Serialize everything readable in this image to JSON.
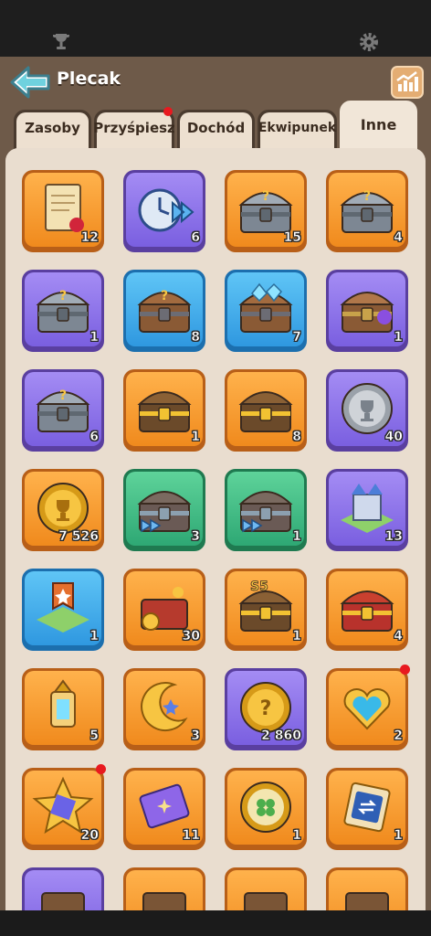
{
  "header": {
    "title": "Plecak",
    "back_icon": "back-arrow-icon",
    "stats_icon": "stats-chart-icon"
  },
  "top_icons": {
    "left": "trophy-icon",
    "right": "gear-icon"
  },
  "tabs": [
    {
      "label": "Zasoby",
      "active": false,
      "badge": false
    },
    {
      "label": "Przyśpiesz",
      "active": false,
      "badge": true
    },
    {
      "label": "Dochód",
      "active": false,
      "badge": false
    },
    {
      "label": "Ekwipunek",
      "active": false,
      "badge": false
    },
    {
      "label": "Inne",
      "active": true,
      "badge": false
    }
  ],
  "items": [
    {
      "icon": "scroll-icon",
      "count": "12",
      "rarity": "orange",
      "badge": false
    },
    {
      "icon": "speedup-clock-icon",
      "count": "6",
      "rarity": "purple",
      "badge": false
    },
    {
      "icon": "mystery-chest-silver-icon",
      "count": "15",
      "rarity": "orange",
      "badge": false
    },
    {
      "icon": "mystery-chest-ticket-icon",
      "count": "4",
      "rarity": "orange",
      "badge": false
    },
    {
      "icon": "mystery-chest-key-icon",
      "count": "1",
      "rarity": "purple",
      "badge": false
    },
    {
      "icon": "mystery-chest-wood-icon",
      "count": "8",
      "rarity": "blue",
      "badge": false
    },
    {
      "icon": "crystal-chest-icon",
      "count": "7",
      "rarity": "blue",
      "badge": false
    },
    {
      "icon": "gem-chest-icon",
      "count": "1",
      "rarity": "purple",
      "badge": false
    },
    {
      "icon": "iron-chest-icon",
      "count": "6",
      "rarity": "purple",
      "badge": false
    },
    {
      "icon": "gold-chest-icon",
      "count": "1",
      "rarity": "orange",
      "badge": false
    },
    {
      "icon": "lion-gold-chest-icon",
      "count": "8",
      "rarity": "orange",
      "badge": false
    },
    {
      "icon": "silver-trophy-coin-icon",
      "count": "40",
      "rarity": "purple",
      "badge": false
    },
    {
      "icon": "gold-trophy-coin-icon",
      "count": "7 526",
      "rarity": "orange",
      "badge": false
    },
    {
      "icon": "speed-chest-icon",
      "count": "3",
      "rarity": "green",
      "badge": false
    },
    {
      "icon": "speed-chest-alt-icon",
      "count": "1",
      "rarity": "green",
      "badge": false
    },
    {
      "icon": "castle-icon",
      "count": "13",
      "rarity": "purple",
      "badge": false
    },
    {
      "icon": "banner-tile-icon",
      "count": "1",
      "rarity": "blue",
      "badge": false
    },
    {
      "icon": "treasure-pile-icon",
      "count": "30",
      "rarity": "orange",
      "badge": false
    },
    {
      "icon": "s5-chest-icon",
      "count": "1",
      "rarity": "orange",
      "badge": false
    },
    {
      "icon": "red-gold-chest-icon",
      "count": "4",
      "rarity": "orange",
      "badge": false
    },
    {
      "icon": "lantern-icon",
      "count": "5",
      "rarity": "orange",
      "badge": false
    },
    {
      "icon": "moon-star-icon",
      "count": "3",
      "rarity": "orange",
      "badge": false
    },
    {
      "icon": "mystery-coin-icon",
      "count": "2 860",
      "rarity": "purple",
      "badge": false
    },
    {
      "icon": "heart-pendant-icon",
      "count": "2",
      "rarity": "orange",
      "badge": true
    },
    {
      "icon": "star-gem-icon",
      "count": "20",
      "rarity": "orange",
      "badge": true
    },
    {
      "icon": "purple-ticket-icon",
      "count": "11",
      "rarity": "orange",
      "badge": false
    },
    {
      "icon": "clover-coin-icon",
      "count": "1",
      "rarity": "orange",
      "badge": false
    },
    {
      "icon": "swap-ticket-icon",
      "count": "1",
      "rarity": "orange",
      "badge": false
    },
    {
      "icon": "item-partial-icon",
      "count": "",
      "rarity": "purple",
      "badge": false
    },
    {
      "icon": "item-partial-icon",
      "count": "",
      "rarity": "orange",
      "badge": false
    },
    {
      "icon": "item-partial-icon",
      "count": "",
      "rarity": "orange",
      "badge": false
    },
    {
      "icon": "item-partial-icon",
      "count": "",
      "rarity": "orange",
      "badge": false
    }
  ]
}
